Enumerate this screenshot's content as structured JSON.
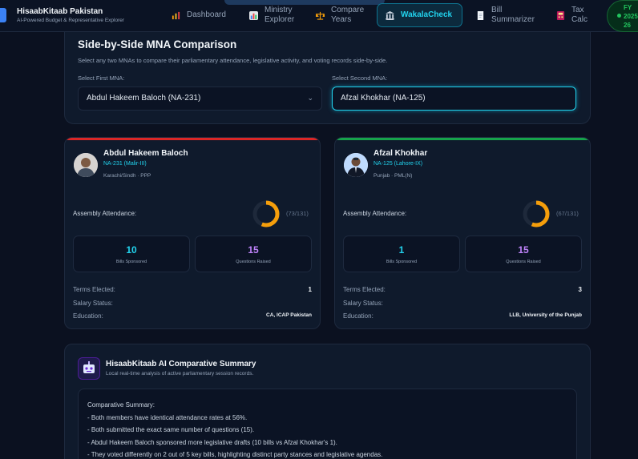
{
  "brand": {
    "title": "HisaabKitaab Pakistan",
    "subtitle": "AI-Powered Budget & Representative Explorer"
  },
  "nav": [
    {
      "label": "Dashboard",
      "icon": "dashboard-icon"
    },
    {
      "label": "Ministry Explorer",
      "icon": "bar-chart-icon"
    },
    {
      "label": "Compare Years",
      "icon": "scales-icon"
    },
    {
      "label": "WakalaCheck",
      "icon": "building-icon",
      "active": true
    },
    {
      "label": "Bill Summarizer",
      "icon": "document-icon"
    },
    {
      "label": "Tax Calc",
      "icon": "calculator-icon"
    }
  ],
  "fiscal_year": {
    "line1": "FY",
    "line2": "2025-",
    "line3": "26"
  },
  "comparison": {
    "title": "Side-by-Side MNA Comparison",
    "description": "Select any two MNAs to compare their parliamentary attendance, legislative activity, and voting records side-by-side.",
    "first_label": "Select First MNA:",
    "first_value": "Abdul Hakeem Baloch (NA-231)",
    "second_label": "Select Second MNA:",
    "second_value": "Afzal Khokhar (NA-125)"
  },
  "mnas": [
    {
      "name": "Abdul Hakeem Baloch",
      "constituency": "NA-231 (Malir-III)",
      "region_party": "Karachi/Sindh · PPP",
      "accent": "#dc2626",
      "attendance_label": "Assembly Attendance:",
      "attendance_fraction": 0.56,
      "attendance_text": "(73/131)",
      "bills": "10",
      "bills_label": "Bills Sponsored",
      "questions": "15",
      "questions_label": "Questions Raised",
      "terms_label": "Terms Elected:",
      "terms": "1",
      "salary_label": "Salary Status:",
      "salary": "",
      "education_label": "Education:",
      "education": "CA, ICAP Pakistan"
    },
    {
      "name": "Afzal Khokhar",
      "constituency": "NA-125 (Lahore-IX)",
      "region_party": "Punjab · PML(N)",
      "accent": "#16a34a",
      "attendance_label": "Assembly Attendance:",
      "attendance_fraction": 0.56,
      "attendance_text": "(67/131)",
      "bills": "1",
      "bills_label": "Bills Sponsored",
      "questions": "15",
      "questions_label": "Questions Raised",
      "terms_label": "Terms Elected:",
      "terms": "3",
      "salary_label": "Salary Status:",
      "salary": "",
      "education_label": "Education:",
      "education": "LLB, University of the Punjab"
    }
  ],
  "summary": {
    "title": "HisaabKitaab AI Comparative Summary",
    "subtitle": "Local real-time analysis of active parliamentary session records.",
    "heading": "Comparative Summary:",
    "lines": [
      "- Both members have identical attendance rates at 56%.",
      "- Both submitted the exact same number of questions (15).",
      "- Abdul Hakeem Baloch sponsored more legislative drafts (10 bills vs Afzal Khokhar's 1).",
      "- They voted differently on 2 out of 5 key bills, highlighting distinct party stances and legislative agendas."
    ]
  },
  "colors": {
    "accent": "#22d3ee",
    "orange": "#f59e0b",
    "bills": "#22d3ee",
    "questions": "#c084fc"
  }
}
